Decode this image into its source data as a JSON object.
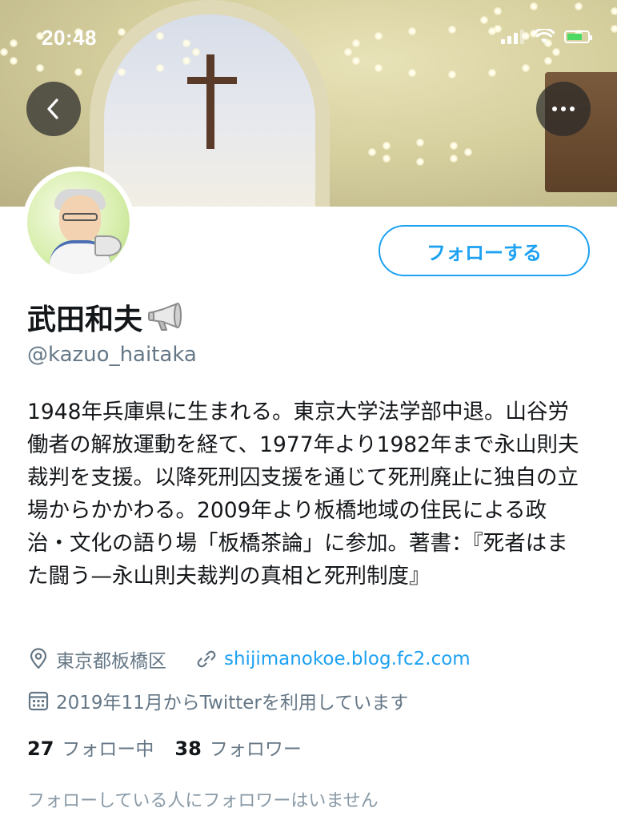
{
  "status_bar": {
    "time": "20:48",
    "battery_color": "#4cd964"
  },
  "header": {
    "back_icon": "chevron-left-icon",
    "more_icon": "more-horizontal-icon"
  },
  "profile": {
    "display_name": "武田和夫",
    "name_emoji_icon": "megaphone-icon",
    "handle": "@kazuo_haitaka",
    "follow_button_label": "フォローする",
    "bio": "1948年兵庫県に生まれる。東京大学法学部中退。山谷労働者の解放運動を経て、1977年より1982年まで永山則夫裁判を支援。以降死刑囚支援を通じて死刑廃止に独自の立場からかかわる。2009年より板橋地域の住民による政治・文化の語り場「板橋茶論」に参加。著書：『死者はまた闘う—永山則夫裁判の真相と死刑制度』",
    "location": "東京都板橋区",
    "website": "shijimanokoe.blog.fc2.com",
    "joined": "2019年11月からTwitterを利用しています",
    "following_count": "27",
    "following_label": "フォロー中",
    "followers_count": "38",
    "followers_label": "フォロワー",
    "followers_you_know": "フォローしている人にフォロワーはいません"
  },
  "colors": {
    "accent": "#1da1f2",
    "secondary_text": "#657786"
  }
}
